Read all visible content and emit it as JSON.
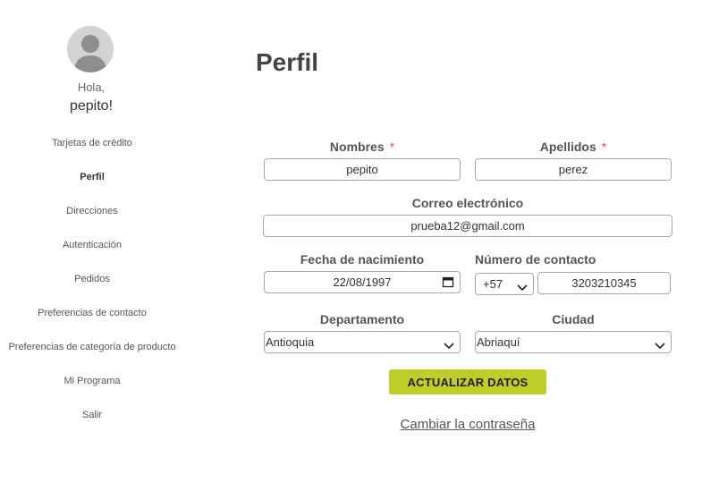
{
  "sidebar": {
    "greeting": "Hola,",
    "user_name": "pepito!",
    "items": [
      {
        "label": "Tarjetas de crédito",
        "active": false
      },
      {
        "label": "Perfil",
        "active": true
      },
      {
        "label": "Direcciones",
        "active": false
      },
      {
        "label": "Autenticación",
        "active": false
      },
      {
        "label": "Pedidos",
        "active": false
      },
      {
        "label": "Preferencias de contacto",
        "active": false
      },
      {
        "label": "Preferencias de categoría de producto",
        "active": false
      },
      {
        "label": "Mi Programa",
        "active": false
      },
      {
        "label": "Salir",
        "active": false
      }
    ]
  },
  "main": {
    "title": "Perfil",
    "form": {
      "nombres": {
        "label": "Nombres",
        "required_mark": "*",
        "value": "pepito"
      },
      "apellidos": {
        "label": "Apellidos",
        "required_mark": "*",
        "value": "perez"
      },
      "correo": {
        "label": "Correo electrónico",
        "value": "prueba12@gmail.com"
      },
      "fecha": {
        "label": "Fecha de nacimiento",
        "value": "22/08/1997"
      },
      "contacto": {
        "label": "Número de contacto",
        "country_code": "+57",
        "value": "3203210345"
      },
      "departamento": {
        "label": "Departamento",
        "value": "Antioquia"
      },
      "ciudad": {
        "label": "Ciudad",
        "value": "Abriaquí"
      }
    },
    "update_button": "ACTUALIZAR DATOS",
    "change_password_link": "Cambiar la contraseña"
  },
  "colors": {
    "accent": "#bfcd2a",
    "required": "#e05555",
    "border": "#a9a9a9",
    "avatar_bg": "#d3d3d3"
  },
  "icons": [
    "user-avatar-icon",
    "calendar-icon",
    "chevron-down-icon"
  ]
}
